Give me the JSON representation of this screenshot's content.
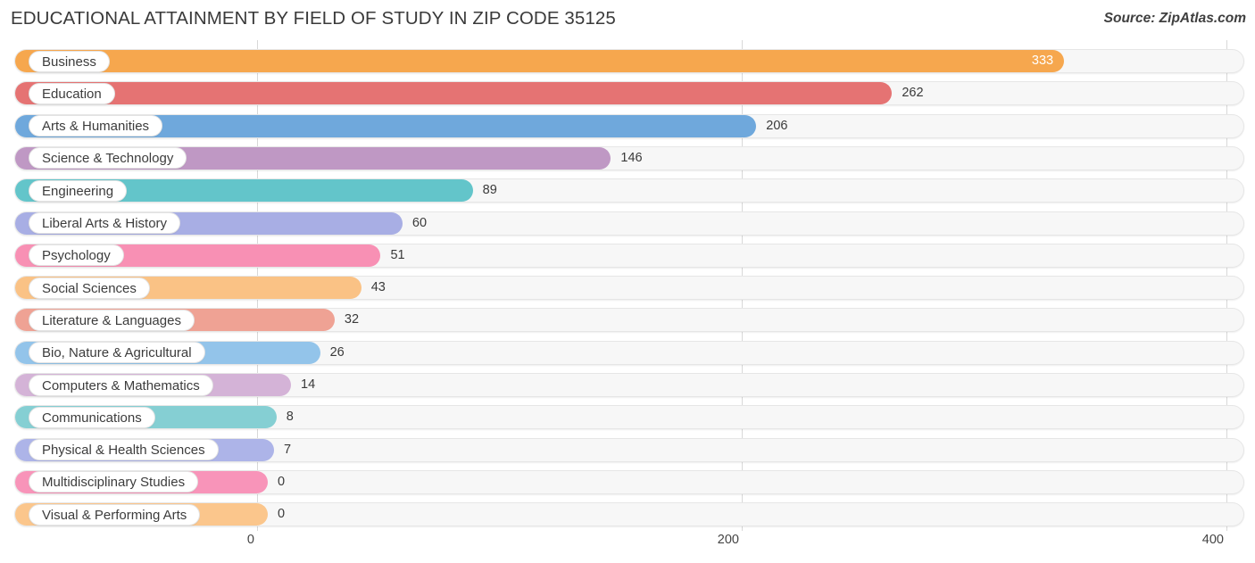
{
  "header": {
    "title": "EDUCATIONAL ATTAINMENT BY FIELD OF STUDY IN ZIP CODE 35125",
    "source": "Source: ZipAtlas.com"
  },
  "chart_data": {
    "type": "bar",
    "orientation": "horizontal",
    "title": "EDUCATIONAL ATTAINMENT BY FIELD OF STUDY IN ZIP CODE 35125",
    "subtitle": "",
    "xlabel": "",
    "ylabel": "",
    "xlim": [
      0,
      400
    ],
    "xticks": [
      0,
      200,
      400
    ],
    "xtick_labels": [
      "0",
      "200",
      "400"
    ],
    "grid": true,
    "legend": false,
    "categories": [
      "Business",
      "Education",
      "Arts & Humanities",
      "Science & Technology",
      "Engineering",
      "Liberal Arts & History",
      "Psychology",
      "Social Sciences",
      "Literature & Languages",
      "Bio, Nature & Agricultural",
      "Computers & Mathematics",
      "Communications",
      "Physical & Health Sciences",
      "Multidisciplinary Studies",
      "Visual & Performing Arts"
    ],
    "values": [
      333,
      262,
      206,
      146,
      89,
      60,
      51,
      43,
      32,
      26,
      14,
      8,
      7,
      0,
      0
    ],
    "value_labels": [
      "333",
      "262",
      "206",
      "146",
      "89",
      "60",
      "51",
      "43",
      "32",
      "26",
      "14",
      "8",
      "7",
      "0",
      "0"
    ],
    "colors": [
      "#f6a74e",
      "#e57373",
      "#6fa8dc",
      "#bf98c4",
      "#63c5ca",
      "#a8aee4",
      "#f890b4",
      "#fac285",
      "#efa294",
      "#93c4ea",
      "#d4b3d7",
      "#85cfd3",
      "#adb4e8",
      "#f894b9",
      "#fbc68c"
    ]
  },
  "axis": {
    "ticks": [
      "0",
      "200",
      "400"
    ]
  }
}
